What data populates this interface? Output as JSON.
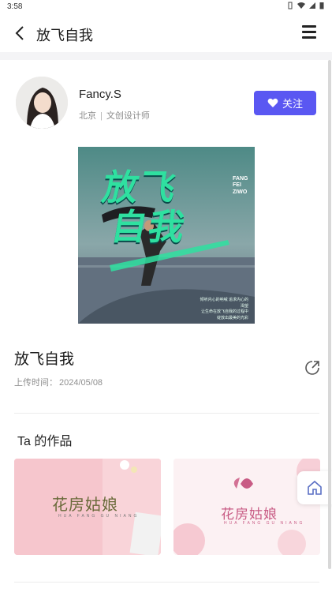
{
  "status_bar": {
    "time": "3:58"
  },
  "header": {
    "title": "放飞自我"
  },
  "author": {
    "name": "Fancy.S",
    "city": "北京",
    "separator": "|",
    "role": "文创设计师",
    "follow_label": "关注"
  },
  "post": {
    "cover": {
      "title_line1": "放飞",
      "title_line2": "自我",
      "pinyin": [
        "FANG",
        "FEI",
        "ZIWO"
      ],
      "caption": [
        "倾听内心的呐喊 追求内心的渴望",
        "让生命在放飞自我的过程中",
        "绽放出最美的光彩"
      ]
    },
    "title": "放飞自我",
    "upload_label": "上传时间：",
    "upload_date": "2024/05/08"
  },
  "works": {
    "heading": "Ta 的作品",
    "items": [
      {
        "title": "花房姑娘",
        "subtitle": "HUA FANG GU NIANG",
        "accent": "#f6c4cc"
      },
      {
        "title": "花房姑娘",
        "subtitle": "HUA FANG GU NIANG",
        "accent": "#c85b84"
      }
    ]
  },
  "colors": {
    "primary": "#5a57f2",
    "cover_green": "#2fe0a0"
  },
  "icons": [
    "back-arrow-icon",
    "menu-icon",
    "heart-icon",
    "share-icon",
    "home-icon"
  ]
}
